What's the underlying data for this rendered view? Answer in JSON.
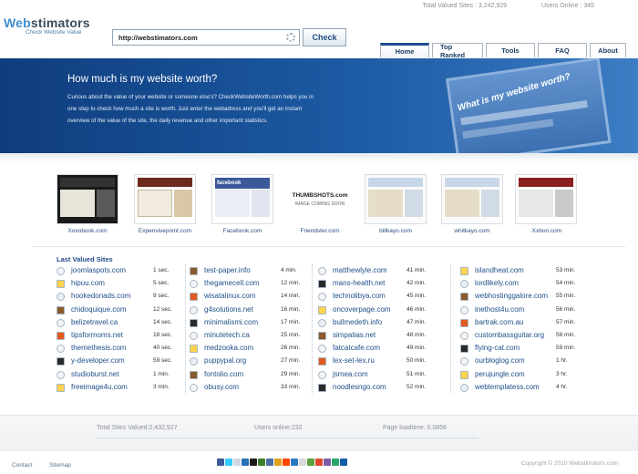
{
  "top_stats": {
    "valued_label": "Total Valued Sites :",
    "valued_value": "3,242,929",
    "online_label": "Users Online :",
    "online_value": "345"
  },
  "logo": {
    "name_a": "Web",
    "name_b": "stimators",
    "tagline": "Check Website Value"
  },
  "search": {
    "value": "http://webstimators.com",
    "button": "Check"
  },
  "nav": [
    "Home",
    "Top Ranked",
    "Tools",
    "FAQ",
    "About"
  ],
  "banner": {
    "title": "How much is my website worth?",
    "text": "Curious about the value of your website or someone else's? CheckWebsiteWorth.com helps you in one step to check how much a site is worth. Just enter the webadress and you'll get an instant overview of the value of the site, the daily revenue and other important statistics.",
    "art_title": "What is my website worth?"
  },
  "thumbnails": [
    {
      "caption": "Xoxobook.com",
      "thumb_text": ""
    },
    {
      "caption": "Expensivepoint.com",
      "thumb_text": ""
    },
    {
      "caption": "Facebook.com",
      "thumb_text": "facebook"
    },
    {
      "caption": "Friendster.com",
      "thumb_text": "THUMBSHOTS.com",
      "thumb_sub": "IMAGE COMING SOON"
    },
    {
      "caption": "billkayo.com",
      "thumb_text": ""
    },
    {
      "caption": "whitkayo.com",
      "thumb_text": ""
    },
    {
      "caption": ".Xxbon.com",
      "thumb_text": ""
    }
  ],
  "list_title": "Last Valued Sites",
  "columns": [
    [
      {
        "site": "joomlaspots.com",
        "time": "1 sec."
      },
      {
        "site": "hipuu.com",
        "time": "5 sec."
      },
      {
        "site": "hookedonads.com",
        "time": "9 sec."
      },
      {
        "site": "chidoquique.com",
        "time": "12 sec."
      },
      {
        "site": "belizetravel.ca",
        "time": "14 sec."
      },
      {
        "site": "tipsformoms.net",
        "time": "18 sec."
      },
      {
        "site": "themethesis.com",
        "time": "40 sec."
      },
      {
        "site": "y-developer.com",
        "time": "59 sec."
      },
      {
        "site": "studioburst.net",
        "time": "1 min."
      },
      {
        "site": "freeimage4u.com",
        "time": "3 min."
      }
    ],
    [
      {
        "site": "test-paper.info",
        "time": "4 min."
      },
      {
        "site": "thegamecell.com",
        "time": "12 min."
      },
      {
        "site": "wisatalinux.com",
        "time": "14 min."
      },
      {
        "site": "g4solutions.net",
        "time": "16 min."
      },
      {
        "site": "minimalismi.com",
        "time": "17 min."
      },
      {
        "site": "minutetech.ca",
        "time": "25 min."
      },
      {
        "site": "medzooka.com",
        "time": "26 min."
      },
      {
        "site": "puppypal.org",
        "time": "27 min."
      },
      {
        "site": "fontolio.com",
        "time": "29 min."
      },
      {
        "site": "obusy.com",
        "time": "33 min."
      }
    ],
    [
      {
        "site": "matthewlyle.com",
        "time": "41 min."
      },
      {
        "site": "mans-health.net",
        "time": "42 min."
      },
      {
        "site": "technolibya.com",
        "time": "45 min."
      },
      {
        "site": "oncoverpage.com",
        "time": "46 min."
      },
      {
        "site": "bullmedeth.info",
        "time": "47 min."
      },
      {
        "site": "simpatias.net",
        "time": "48 min."
      },
      {
        "site": "fatcatcafe.com",
        "time": "49 min."
      },
      {
        "site": "lex-set-lex.ru",
        "time": "50 min."
      },
      {
        "site": "jsmea.com",
        "time": "51 min."
      },
      {
        "site": "noodlesngo.com",
        "time": "52 min."
      }
    ],
    [
      {
        "site": "islandheat.com",
        "time": "53 min."
      },
      {
        "site": "lordlikely.com",
        "time": "54 min."
      },
      {
        "site": "webhostinggalore.com",
        "time": "55 min."
      },
      {
        "site": "inethost4u.com",
        "time": "56 min."
      },
      {
        "site": "bartrak.com.au",
        "time": "57 min."
      },
      {
        "site": "custombassguitar.org",
        "time": "58 min."
      },
      {
        "site": "flying-cat.com",
        "time": "59 min."
      },
      {
        "site": "ourbloglog.com",
        "time": "1 hr."
      },
      {
        "site": "perujungle.com",
        "time": "3 hr."
      },
      {
        "site": "webtemplatess.com",
        "time": "4 hr."
      }
    ]
  ],
  "footer": {
    "total_label": "Total Sites Valued:",
    "total_value": "2,432,927",
    "users_label": "Users online:",
    "users_value": "232",
    "load_label": "Page loadtime:",
    "load_value": "0.0856",
    "contact": "Contact",
    "sitemap": "Sitemap",
    "copyright": "Copyright © 2010 Webstimators.com"
  },
  "colors": {
    "brand_blue": "#1c4e8c",
    "link_blue": "#1e4f8a",
    "banner_start": "#0f3d7d",
    "banner_end": "#3c7dc4"
  }
}
